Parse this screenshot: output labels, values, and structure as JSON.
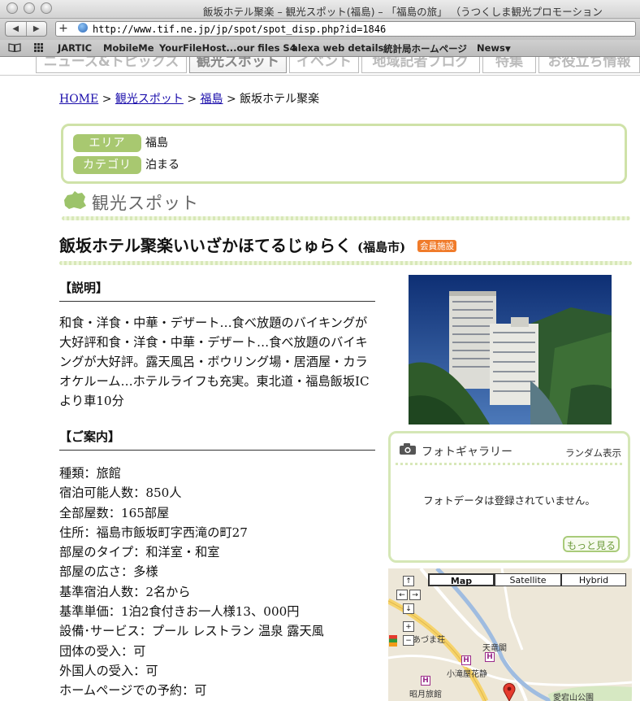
{
  "window": {
    "title": "飯坂ホテル聚楽 – 観光スポット(福島) – 「福島の旅」 （うつくしま観光プロモーション"
  },
  "toolbar": {
    "url": "http://www.tif.ne.jp/jp/spot/spot_disp.php?id=1846"
  },
  "bookmarks": [
    "JARTIC",
    "MobileMe",
    "YourFileHost...our files S4",
    "alexa web details",
    "統計局ホームページ",
    "News"
  ],
  "site_nav": [
    "ニュース&トピックス",
    "観光スポット",
    "イベント",
    "地域記者ブログ",
    "特集",
    "お役立ち情報"
  ],
  "breadcrumb": {
    "home": "HOME",
    "sep": " > ",
    "spots": "観光スポット",
    "area": "福島",
    "current": "飯坂ホテル聚楽"
  },
  "info": {
    "area_label": "エリア",
    "area_value": "福島",
    "category_label": "カテゴリ",
    "category_value": "泊まる"
  },
  "section": {
    "spot_title": "観光スポット"
  },
  "spot": {
    "name": "飯坂ホテル聚楽いいざかほてるじゅらく",
    "pref": "(福島市)",
    "badge": "会員施設",
    "desc_heading": "【説明】",
    "description": "和食・洋食・中華・デザート…食べ放題のバイキングが大好評和食・洋食・中華・デザート…食べ放題のバイキングが大好評。露天風呂・ボウリング場・居酒屋・カラオケルーム…ホテルライフも充実。東北道・福島飯坂ICより車10分",
    "guide_heading": "【ご案内】",
    "guide": [
      "種類：旅館",
      "宿泊可能人数：850人",
      "全部屋数：165部屋",
      "住所：福島市飯坂町字西滝の町27",
      "部屋のタイプ：和洋室・和室",
      "部屋の広さ：多様",
      "基準宿泊人数：2名から",
      "基準単価：1泊2食付きお一人様13、000円",
      "設備･サービス：プール レストラン 温泉 露天風",
      "団体の受入：可",
      "外国人の受入：可",
      "ホームページでの予約：可"
    ]
  },
  "gallery": {
    "title": "フォトギャラリー",
    "random": "ランダム表示",
    "empty": "フォトデータは登録されていません。",
    "more": "もっと見る"
  },
  "map": {
    "types": [
      "Map",
      "Satellite",
      "Hybrid"
    ],
    "labels": {
      "tenryukaku": "天竜閣",
      "azumaso": "あづま荘",
      "kotakibana": "小滝屋花静",
      "shogetsu": "昭月旅館",
      "atagoyama": "愛宕山公園"
    }
  },
  "colors": {
    "green_pill": "#a8c870",
    "border_green": "#cfe2a8",
    "badge_orange": "#f07b2a",
    "link": "#1a0dab"
  }
}
